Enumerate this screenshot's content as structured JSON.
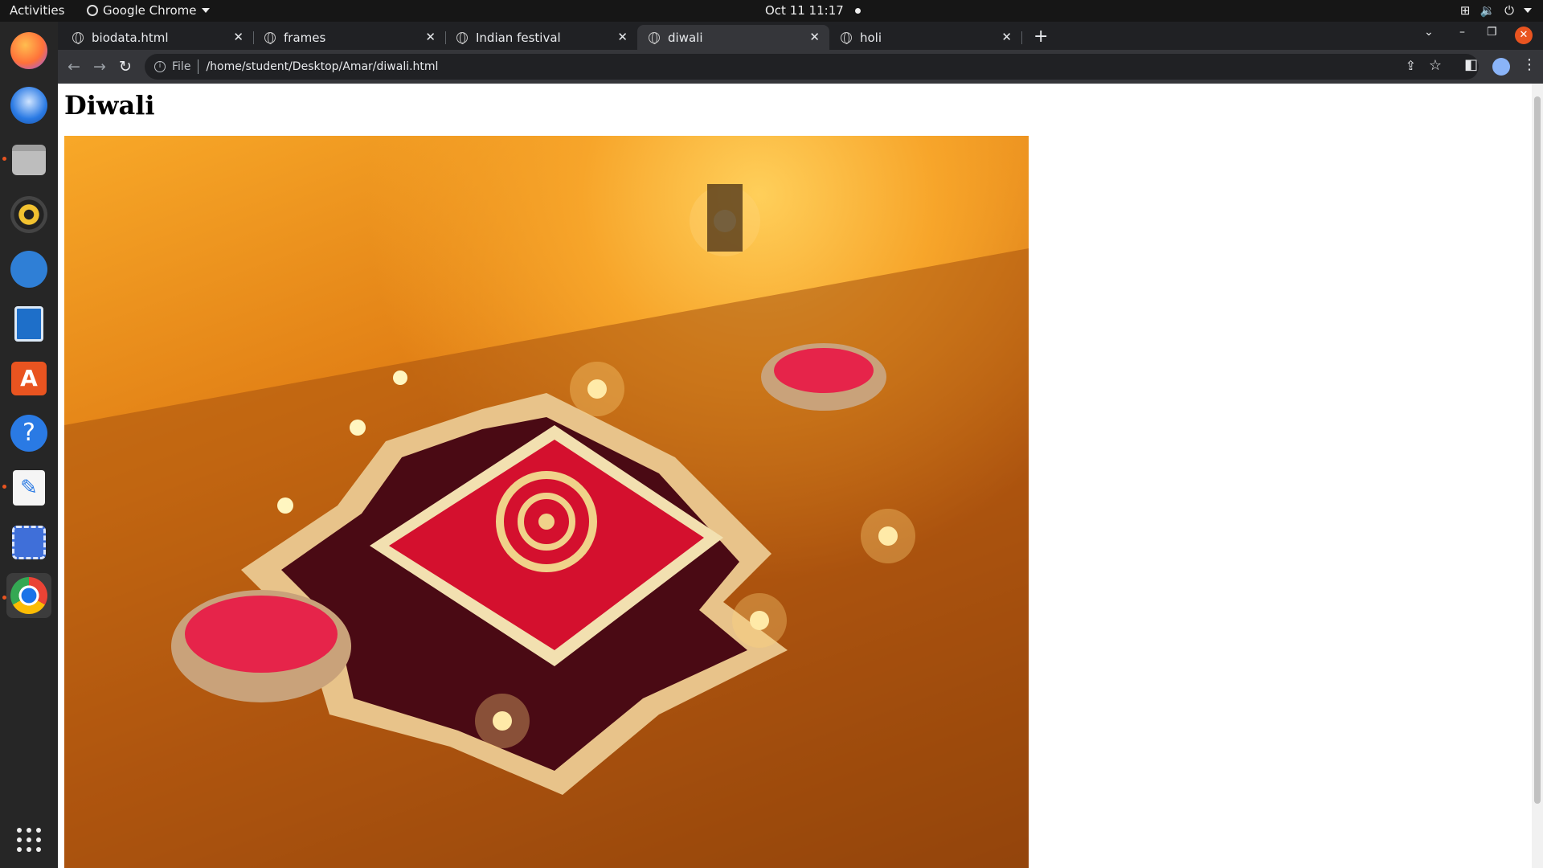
{
  "system_bar": {
    "activities": "Activities",
    "app_name": "Google Chrome",
    "clock": "Oct 11  11:17"
  },
  "browser": {
    "tabs": [
      {
        "label": "biodata.html",
        "active": false
      },
      {
        "label": "frames",
        "active": false
      },
      {
        "label": "Indian festival",
        "active": false
      },
      {
        "label": "diwali",
        "active": true
      },
      {
        "label": "holi",
        "active": false
      }
    ],
    "omnibox": {
      "scheme_label": "File",
      "url": "/home/student/Desktop/Amar/diwali.html"
    }
  },
  "page": {
    "heading": "Diwali",
    "image_subject": "rangoli with diyas"
  },
  "colors": {
    "dock_accent": "#e95420",
    "chrome_dark": "#202124",
    "chrome_toolbar": "#35363a"
  }
}
